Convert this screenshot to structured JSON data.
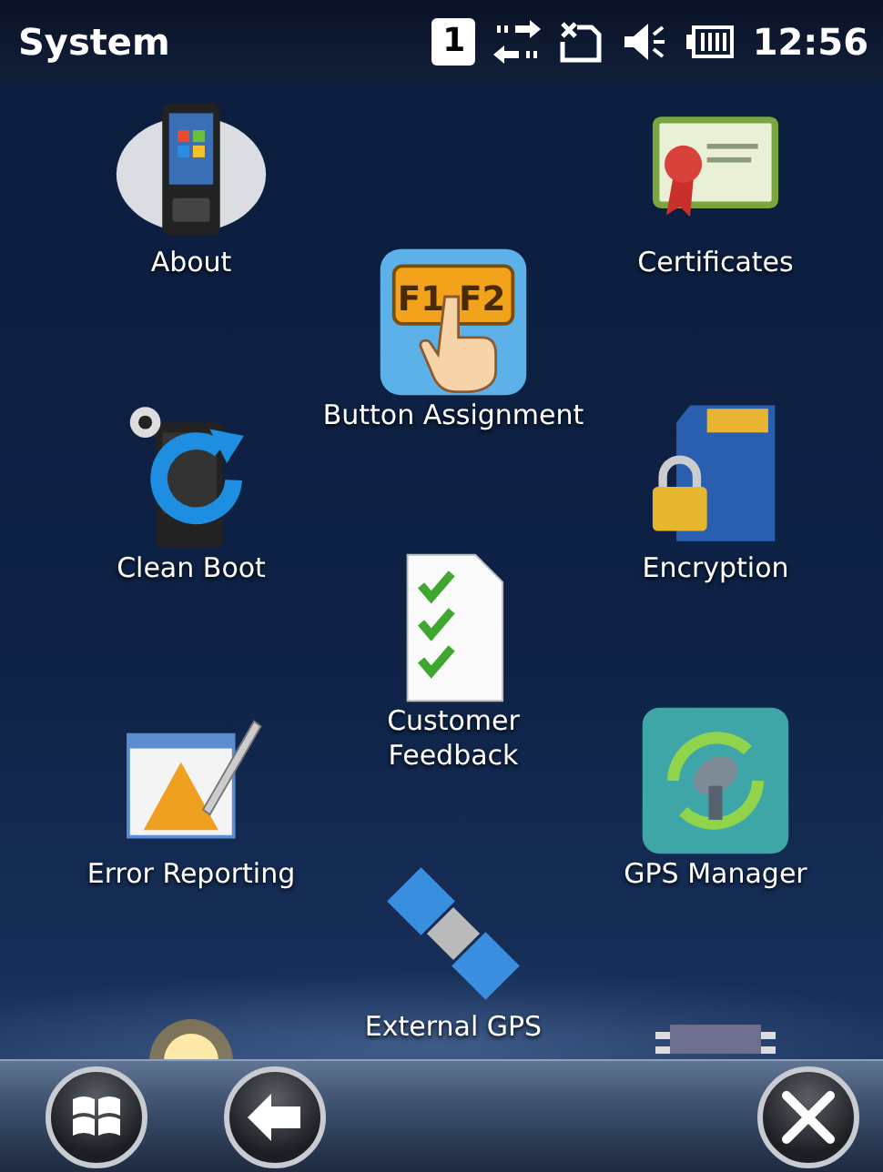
{
  "status_bar": {
    "title": "System",
    "slot": "1",
    "time": "12:56"
  },
  "items": [
    {
      "label": "About"
    },
    {
      "label": "Certificates"
    },
    {
      "label": "Button Assignment",
      "keys": [
        "F1",
        "F2"
      ]
    },
    {
      "label": "Clean Boot"
    },
    {
      "label": "Encryption"
    },
    {
      "label": "Customer\nFeedback"
    },
    {
      "label": "Error Reporting"
    },
    {
      "label": "GPS Manager"
    },
    {
      "label": "External GPS"
    }
  ]
}
